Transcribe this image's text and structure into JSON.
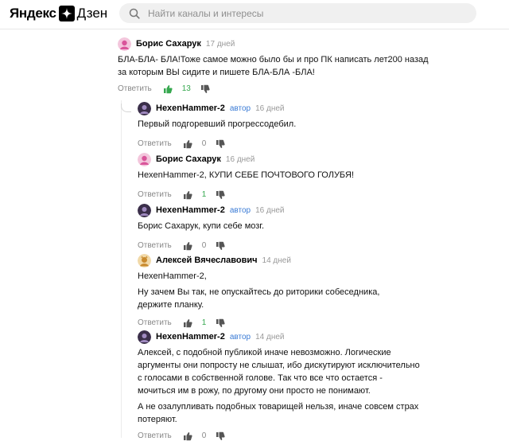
{
  "header": {
    "logo_yandex": "Яндекс",
    "logo_dzen": "Дзен",
    "search_placeholder": "Найти каналы и интересы"
  },
  "actions": {
    "reply_label": "Ответить"
  },
  "comments": [
    {
      "author": "Борис Сахарук",
      "badge": "",
      "time": "17 дней",
      "paragraphs": [
        "БЛА-БЛА- БЛА!Тоже самое можно было бы и про ПК написать лет200 назад за которым ВЫ сидите и пишете БЛА-БЛА -БЛА!"
      ],
      "likes": "13",
      "liked": true
    },
    {
      "author": "HexenHammer-2",
      "badge": "автор",
      "time": "16 дней",
      "paragraphs": [
        "Первый подгоревший прогрессодебил."
      ],
      "likes": "0",
      "liked": false
    },
    {
      "author": "Борис Сахарук",
      "badge": "",
      "time": "16 дней",
      "paragraphs": [
        "HexenHammer-2, КУПИ СЕБЕ ПОЧТОВОГО ГОЛУБЯ!"
      ],
      "likes": "1",
      "liked": true
    },
    {
      "author": "HexenHammer-2",
      "badge": "автор",
      "time": "16 дней",
      "paragraphs": [
        "Борис Сахарук, купи себе мозг."
      ],
      "likes": "0",
      "liked": false
    },
    {
      "author": "Алексей Вячеславович",
      "badge": "",
      "time": "14 дней",
      "paragraphs": [
        "HexenHammer-2,",
        "Ну зачем Вы так, не опускайтесь до риторики собеседника, держите планку."
      ],
      "likes": "1",
      "liked": true
    },
    {
      "author": "HexenHammer-2",
      "badge": "автор",
      "time": "14 дней",
      "paragraphs": [
        "Алексей, с подобной публикой иначе невозможно. Логические аргументы они попросту не слышат, ибо дискутируют исключительно с голосами в собственной голове. Так что все что остается - мочиться им в рожу, по другому они просто не понимают.",
        "А не озалупливать подобных товарищей нельзя, иначе совсем страх потеряют."
      ],
      "likes": "0",
      "liked": false
    }
  ],
  "colors": {
    "like_active": "#36a84f",
    "badge": "#3a7bd5",
    "muted": "#888888"
  },
  "icons": {
    "search": "search-icon",
    "like": "thumbs-up-icon",
    "dislike": "thumbs-down-icon",
    "logo": "dzen-logo-icon"
  }
}
